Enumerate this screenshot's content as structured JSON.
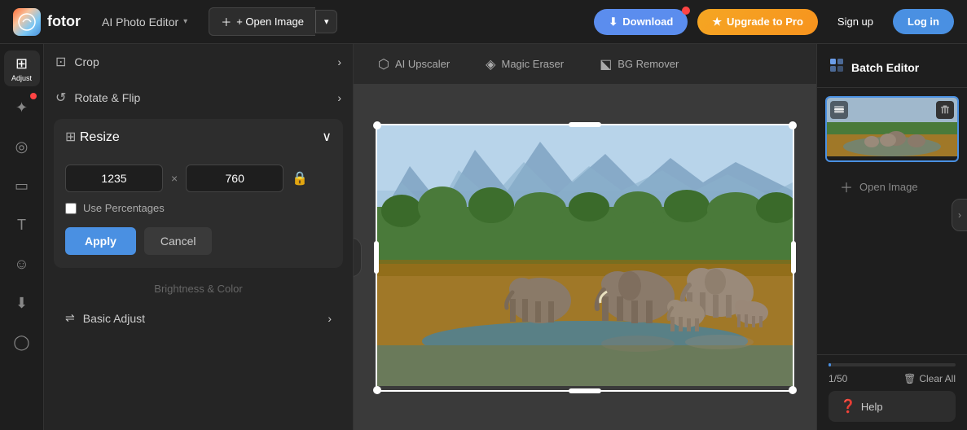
{
  "app": {
    "logo_text": "fotor",
    "title": "AI Photo Editor",
    "title_chevron": "▾"
  },
  "topnav": {
    "open_image_label": "+ Open Image",
    "open_image_arrow": "▾",
    "download_label": "Download",
    "upgrade_label": "Upgrade to Pro",
    "signup_label": "Sign up",
    "login_label": "Log in"
  },
  "icon_sidebar": {
    "items": [
      {
        "icon": "⚡",
        "label": "Adjust",
        "active": true
      },
      {
        "icon": "✦",
        "label": ""
      },
      {
        "icon": "👁",
        "label": ""
      },
      {
        "icon": "▭",
        "label": ""
      },
      {
        "icon": "T",
        "label": ""
      },
      {
        "icon": "☺",
        "label": ""
      },
      {
        "icon": "⬇",
        "label": ""
      },
      {
        "icon": "◯",
        "label": ""
      }
    ]
  },
  "tool_panel": {
    "crop_label": "Crop",
    "rotate_label": "Rotate & Flip",
    "resize_label": "Resize",
    "width_value": "1235",
    "height_value": "760",
    "use_percentages_label": "Use Percentages",
    "apply_label": "Apply",
    "cancel_label": "Cancel",
    "brightness_label": "Brightness & Color",
    "basic_adjust_label": "Basic Adjust"
  },
  "canvas_toolbar": {
    "upscaler_label": "AI Upscaler",
    "magic_eraser_label": "Magic Eraser",
    "bg_remover_label": "BG Remover"
  },
  "right_panel": {
    "batch_editor_label": "Batch Editor",
    "open_image_label": "Open Image",
    "counter": "1/50",
    "clear_all_label": "Clear All",
    "help_label": "Help"
  }
}
